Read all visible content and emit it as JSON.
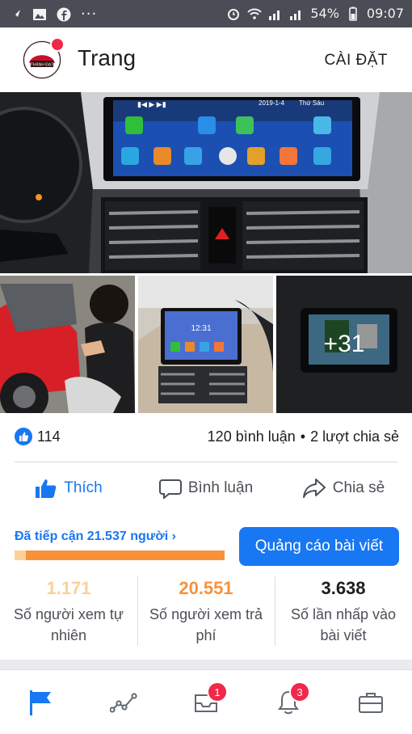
{
  "status_bar": {
    "battery": "54%",
    "time": "09:07",
    "notification_icons": [
      "arrow-icon",
      "image-icon",
      "facebook-icon",
      "more-icon"
    ],
    "system_icons": [
      "alarm-icon",
      "wifi-icon",
      "signal-icon",
      "signal-icon",
      "battery-icon"
    ]
  },
  "header": {
    "page_title": "Trang",
    "settings_label": "CÀI ĐẶT",
    "logo_text": "THÀNH ĐẠT"
  },
  "photos": {
    "more_count": "+31",
    "head_unit_date": "2019-1-4",
    "head_unit_day": "Thứ Sáu",
    "small_screen_time": "12:31"
  },
  "stats": {
    "likes": "114",
    "comments": "120 bình luận",
    "separator": "•",
    "shares": "2 lượt chia sẻ"
  },
  "actions": {
    "like": "Thích",
    "comment": "Bình luận",
    "share": "Chia sẻ"
  },
  "reach": {
    "label": "Đã tiếp cận 21.537 người",
    "chevron": "›",
    "organic_fraction": 0.054,
    "promote_button": "Quảng cáo bài viết"
  },
  "metrics": [
    {
      "value": "1.171",
      "label": "Số người xem tự nhiên",
      "color": "#fcd09a"
    },
    {
      "value": "20.551",
      "label": "Số người xem trả phí",
      "color": "#f7923a"
    },
    {
      "value": "3.638",
      "label": "Số lần nhấp vào bài viết",
      "color": "#1c1e21"
    }
  ],
  "bottom_nav": {
    "messages_badge": "1",
    "notifications_badge": "3",
    "items": [
      "flag-icon",
      "insights-icon",
      "inbox-icon",
      "bell-icon",
      "briefcase-icon"
    ]
  },
  "colors": {
    "accent": "#1877f2",
    "badge": "#f02849"
  }
}
